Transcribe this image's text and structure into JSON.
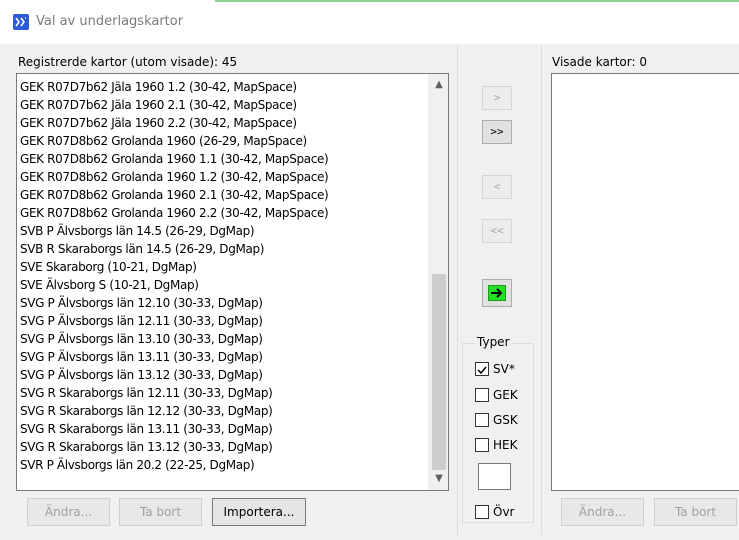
{
  "window": {
    "title": "Val av underlagskartor"
  },
  "left_panel": {
    "label": "Registrerde kartor (utom visade): 45",
    "items": [
      "GEK R07D7b62 Jäla 1960 1.2 (30-42, MapSpace)",
      "GEK R07D7b62 Jäla 1960 2.1 (30-42, MapSpace)",
      "GEK R07D7b62 Jäla 1960 2.2 (30-42, MapSpace)",
      "GEK R07D8b62 Grolanda 1960 (26-29, MapSpace)",
      "GEK R07D8b62 Grolanda 1960 1.1 (30-42, MapSpace)",
      "GEK R07D8b62 Grolanda 1960 1.2 (30-42, MapSpace)",
      "GEK R07D8b62 Grolanda 1960 2.1 (30-42, MapSpace)",
      "GEK R07D8b62 Grolanda 1960 2.2 (30-42, MapSpace)",
      "SVB P Älvsborgs län 14.5 (26-29, DgMap)",
      "SVB R Skaraborgs län 14.5 (26-29, DgMap)",
      "SVE Skaraborg (10-21, DgMap)",
      "SVE Älvsborg S (10-21, DgMap)",
      "SVG P Älvsborgs län 12.10 (30-33, DgMap)",
      "SVG P Älvsborgs län 12.11 (30-33, DgMap)",
      "SVG P Älvsborgs län 13.10 (30-33, DgMap)",
      "SVG P Älvsborgs län 13.11 (30-33, DgMap)",
      "SVG P Älvsborgs län 13.12 (30-33, DgMap)",
      "SVG R Skaraborgs län 12.11 (30-33, DgMap)",
      "SVG R Skaraborgs län 12.12 (30-33, DgMap)",
      "SVG R Skaraborgs län 13.11 (30-33, DgMap)",
      "SVG R Skaraborgs län 13.12 (30-33, DgMap)",
      "SVR P Älvsborgs län 20.2 (22-25, DgMap)"
    ],
    "buttons": {
      "edit": "Ändra...",
      "delete": "Ta bort",
      "import": "Importera..."
    }
  },
  "middle": {
    "add_one": ">",
    "add_all": ">>",
    "remove_one": "<",
    "remove_all": "<<",
    "apply_icon": "green-arrow-icon",
    "types_group": {
      "label": "Typer",
      "checkboxes": [
        {
          "label": "SV*",
          "checked": true
        },
        {
          "label": "GEK",
          "checked": false
        },
        {
          "label": "GSK",
          "checked": false
        },
        {
          "label": "HEK",
          "checked": false
        }
      ],
      "other_label": "Övr",
      "other_checked": false
    }
  },
  "right_panel": {
    "label": "Visade kartor: 0",
    "buttons": {
      "edit": "Ändra...",
      "delete": "Ta bort"
    }
  },
  "colors": {
    "accent_green": "#22e022",
    "title_icon": "#2b5bd7"
  }
}
